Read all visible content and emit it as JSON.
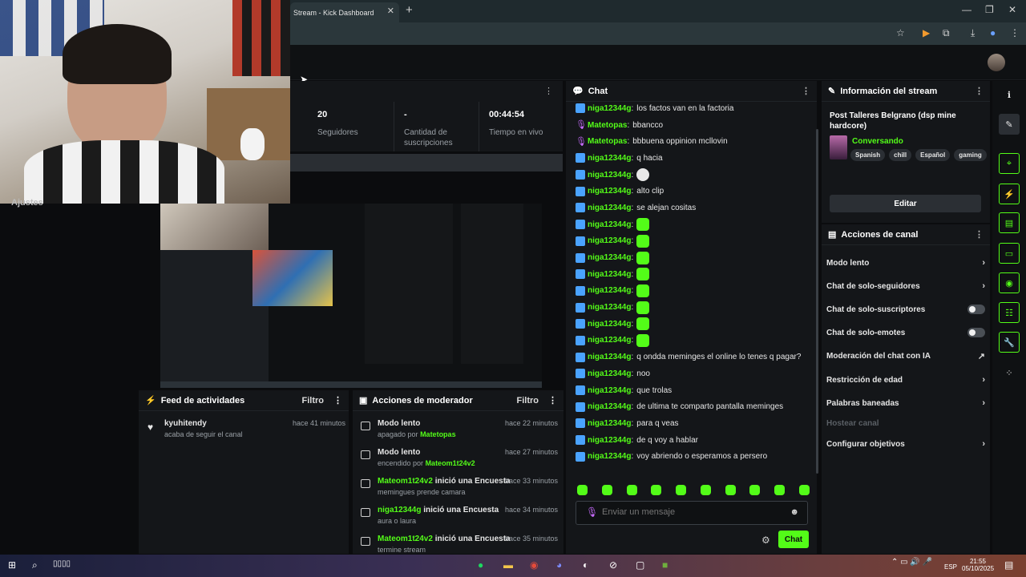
{
  "browser": {
    "tab_title": "Stream - Kick Dashboard",
    "close": "✕",
    "new_tab": "+"
  },
  "stats": [
    {
      "value": "20",
      "label": "Seguidores"
    },
    {
      "value": "-",
      "label": "Cantidad de suscripciones"
    },
    {
      "value": "00:44:54",
      "label": "Tiempo en vivo"
    }
  ],
  "sidebar": {
    "ajustes": "Ajustes"
  },
  "feed": {
    "title": "Feed de actividades",
    "filter": "Filtro",
    "items": [
      {
        "user": "kyuhitendy",
        "text": "acaba de seguir el canal",
        "time": "hace 41 minutos"
      }
    ]
  },
  "mod": {
    "title": "Acciones de moderador",
    "filter": "Filtro",
    "items": [
      {
        "title": "Modo lento",
        "actor": "",
        "sub_prefix": "apagado por",
        "sub_user": "Matetopas",
        "sub_text": "",
        "time": "hace 22 minutos"
      },
      {
        "title": "Modo lento",
        "actor": "",
        "sub_prefix": "encendido por",
        "sub_user": "Mateom1t24v2",
        "sub_text": "",
        "time": "hace 27 minutos"
      },
      {
        "title": "inició una Encuesta",
        "actor": "Mateom1t24v2",
        "sub_prefix": "",
        "sub_user": "",
        "sub_text": "memingues prende camara",
        "time": "hace 33 minutos"
      },
      {
        "title": "inició una Encuesta",
        "actor": "niga12344g",
        "sub_prefix": "",
        "sub_user": "",
        "sub_text": "aura o laura",
        "time": "hace 34 minutos"
      },
      {
        "title": "inició una Encuesta",
        "actor": "Mateom1t24v2",
        "sub_prefix": "",
        "sub_user": "",
        "sub_text": "termine stream",
        "time": "hace 35 minutos"
      }
    ]
  },
  "chat": {
    "title": "Chat",
    "messages": [
      {
        "badge": "kick",
        "user": "niga12344g",
        "text": "los factos van en la factoria",
        "emote": ""
      },
      {
        "badge": "mic",
        "user": "Matetopas",
        "text": "bbancco",
        "emote": ""
      },
      {
        "badge": "mic",
        "user": "Matetopas",
        "text": "bbbuena oppinion mcllovin",
        "emote": ""
      },
      {
        "badge": "kick",
        "user": "niga12344g",
        "text": "q hacia",
        "emote": ""
      },
      {
        "badge": "kick",
        "user": "niga12344g",
        "text": "",
        "emote": "skull"
      },
      {
        "badge": "kick",
        "user": "niga12344g",
        "text": "alto clip",
        "emote": ""
      },
      {
        "badge": "kick",
        "user": "niga12344g",
        "text": "se alejan cositas",
        "emote": ""
      },
      {
        "badge": "kick",
        "user": "niga12344g",
        "text": "",
        "emote": "green"
      },
      {
        "badge": "kick",
        "user": "niga12344g",
        "text": "",
        "emote": "green"
      },
      {
        "badge": "kick",
        "user": "niga12344g",
        "text": "",
        "emote": "green"
      },
      {
        "badge": "kick",
        "user": "niga12344g",
        "text": "",
        "emote": "green"
      },
      {
        "badge": "kick",
        "user": "niga12344g",
        "text": "",
        "emote": "green"
      },
      {
        "badge": "kick",
        "user": "niga12344g",
        "text": "",
        "emote": "green"
      },
      {
        "badge": "kick",
        "user": "niga12344g",
        "text": "",
        "emote": "green"
      },
      {
        "badge": "kick",
        "user": "niga12344g",
        "text": "",
        "emote": "green"
      },
      {
        "badge": "kick",
        "user": "niga12344g",
        "text": "q ondda meminges el online lo tenes q pagar?",
        "emote": ""
      },
      {
        "badge": "kick",
        "user": "niga12344g",
        "text": "noo",
        "emote": ""
      },
      {
        "badge": "kick",
        "user": "niga12344g",
        "text": "que trolas",
        "emote": ""
      },
      {
        "badge": "kick",
        "user": "niga12344g",
        "text": "de ultima te comparto pantalla meminges",
        "emote": ""
      },
      {
        "badge": "kick",
        "user": "niga12344g",
        "text": "para q veas",
        "emote": ""
      },
      {
        "badge": "kick",
        "user": "niga12344g",
        "text": "de q voy a hablar",
        "emote": ""
      },
      {
        "badge": "kick",
        "user": "niga12344g",
        "text": "voy abriendo o esperamos a persero",
        "emote": ""
      }
    ],
    "input_placeholder": "Enviar un mensaje",
    "send_label": "Chat"
  },
  "info": {
    "title": "Información del stream",
    "stream_title": "Post Talleres Belgrano (dsp mine hardcore)",
    "category": "Conversando",
    "tags": [
      "Spanish",
      "chill",
      "Español",
      "gaming"
    ],
    "edit_label": "Editar"
  },
  "actions": {
    "title": "Acciones de canal",
    "items": [
      {
        "label": "Modo lento",
        "control": "arrow"
      },
      {
        "label": "Chat de solo-seguidores",
        "control": "arrow"
      },
      {
        "label": "Chat de solo-suscriptores",
        "control": "toggle"
      },
      {
        "label": "Chat de solo-emotes",
        "control": "toggle"
      },
      {
        "label": "Moderación del chat con IA",
        "control": "external"
      },
      {
        "label": "Restricción de edad",
        "control": "arrow"
      },
      {
        "label": "Palabras baneadas",
        "control": "arrow"
      },
      {
        "label": "Hostear canal",
        "control": "disabled"
      },
      {
        "label": "Configurar objetivos",
        "control": "arrow"
      }
    ]
  },
  "taskbar": {
    "lang": "ESP",
    "time": "21:55",
    "date": "05/10/2025"
  },
  "colors": {
    "accent": "#53fc18",
    "bg": "#0b0c0e",
    "panel": "#141619"
  }
}
